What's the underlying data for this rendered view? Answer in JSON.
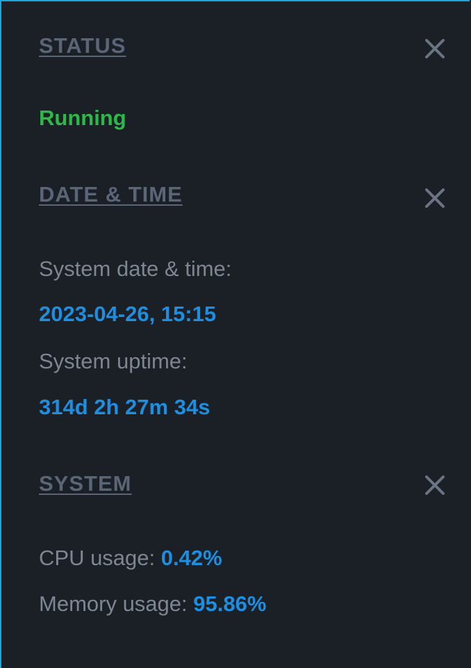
{
  "status": {
    "title": "STATUS",
    "value": "Running"
  },
  "datetime": {
    "title": "DATE & TIME",
    "date_label": "System date & time:",
    "date_value": "2023-04-26, 15:15",
    "uptime_label": "System uptime:",
    "uptime_value": "314d 2h 27m 34s"
  },
  "system": {
    "title": "SYSTEM",
    "cpu_label": "CPU usage:",
    "cpu_value": "0.42%",
    "memory_label": "Memory usage:",
    "memory_value": "95.86%"
  },
  "colors": {
    "status_running": "#2fb84a",
    "value_blue": "#1d8ee0",
    "heading": "#5a6577",
    "label": "#7d8693",
    "background": "#1b1f26",
    "border": "#1aa6d8"
  },
  "icons": {
    "close": "close-icon"
  }
}
